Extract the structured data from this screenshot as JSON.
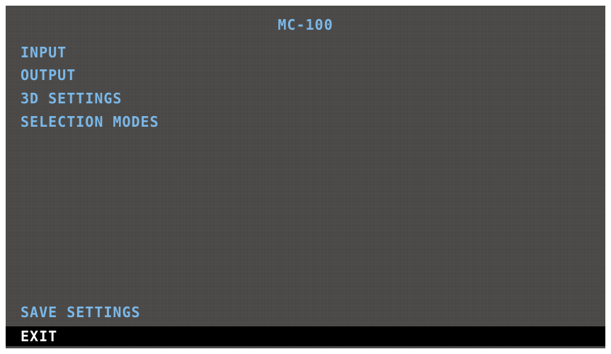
{
  "title": "MC-100",
  "menu": {
    "items": [
      {
        "label": "INPUT"
      },
      {
        "label": "OUTPUT"
      },
      {
        "label": "3D SETTINGS"
      },
      {
        "label": "SELECTION MODES"
      },
      {
        "label": "SAVE SETTINGS"
      },
      {
        "label": "EXIT",
        "selected": true
      }
    ]
  },
  "colors": {
    "background": "#4a4846",
    "text": "#7bb8e8",
    "selected_background": "#000000",
    "selected_text": "#ffffff"
  }
}
